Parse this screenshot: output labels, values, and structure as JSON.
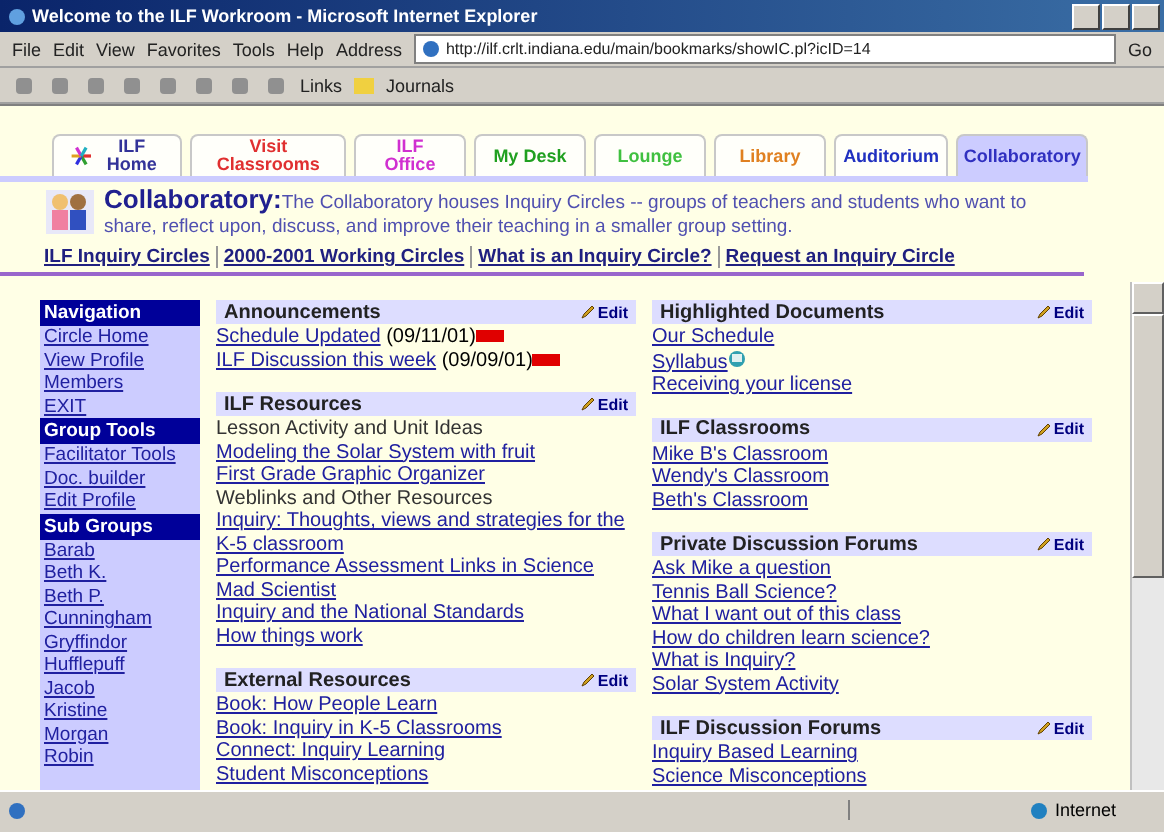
{
  "window": {
    "title": "Welcome to the ILF Workroom - Microsoft Internet Explorer"
  },
  "menu": [
    "File",
    "Edit",
    "View",
    "Favorites",
    "Tools",
    "Help"
  ],
  "address": {
    "label": "Address",
    "url": "http://ilf.crlt.indiana.edu/main/bookmarks/showIC.pl?icID=14",
    "go": "Go"
  },
  "links": {
    "label": "Links",
    "item": "Journals"
  },
  "tabs": [
    {
      "label": "ILF Home",
      "color": "#333399",
      "selected": false,
      "kind": "home"
    },
    {
      "label": "Visit Classrooms",
      "color": "#e03030",
      "selected": false,
      "kind": "text"
    },
    {
      "label": "ILF Office",
      "color": "#d030d0",
      "selected": false,
      "kind": "text"
    },
    {
      "label": "My Desk",
      "color": "#20a020",
      "selected": false,
      "kind": "text"
    },
    {
      "label": "Lounge",
      "color": "#40c040",
      "selected": false,
      "kind": "text"
    },
    {
      "label": "Library",
      "color": "#e08020",
      "selected": false,
      "kind": "text"
    },
    {
      "label": "Auditorium",
      "color": "#2030c0",
      "selected": false,
      "kind": "text"
    },
    {
      "label": "Collaboratory",
      "color": "#3030c0",
      "selected": true,
      "kind": "text"
    }
  ],
  "header": {
    "title": "Collaboratory:",
    "description": "The Collaboratory houses Inquiry Circles -- groups of teachers and students who want to share, reflect upon, discuss, and improve their teaching in a smaller group setting."
  },
  "nav_links": [
    "ILF Inquiry Circles",
    "2000-2001 Working Circles",
    "What is an Inquiry Circle?",
    "Request an Inquiry Circle"
  ],
  "sidebar": [
    {
      "title": "Navigation",
      "items": [
        "Circle Home",
        "View Profile",
        "Members",
        "EXIT"
      ]
    },
    {
      "title": "Group Tools",
      "items": [
        "Facilitator Tools",
        "Doc. builder",
        "Edit Profile"
      ]
    },
    {
      "title": "Sub Groups",
      "items": [
        "Barab",
        "Beth K.",
        "Beth P.",
        "Cunningham",
        "Gryffindor",
        "Hufflepuff",
        "Jacob",
        "Kristine",
        "Morgan",
        "Robin"
      ]
    }
  ],
  "columns": [
    [
      {
        "title": "Announcements",
        "edit": "Edit",
        "items": [
          {
            "kind": "link",
            "text": "Schedule Updated",
            "note": " (09/11/01)",
            "new": true
          },
          {
            "kind": "link",
            "text": "ILF Discussion this week",
            "note": " (09/09/01)",
            "new": true
          }
        ]
      },
      {
        "title": "ILF Resources",
        "edit": "Edit",
        "items": [
          {
            "kind": "text",
            "text": "Lesson Activity and Unit Ideas"
          },
          {
            "kind": "link",
            "text": "Modeling the Solar System with fruit"
          },
          {
            "kind": "link",
            "text": "First Grade Graphic Organizer"
          },
          {
            "kind": "text",
            "text": "Weblinks and Other Resources"
          },
          {
            "kind": "link",
            "text": "Inquiry: Thoughts, views and strategies for the K-5 classroom"
          },
          {
            "kind": "link",
            "text": "Performance Assessment Links in Science"
          },
          {
            "kind": "link",
            "text": "Mad Scientist"
          },
          {
            "kind": "link",
            "text": "Inquiry and the National Standards"
          },
          {
            "kind": "link",
            "text": "How things work"
          }
        ]
      },
      {
        "title": "External Resources",
        "edit": "Edit",
        "items": [
          {
            "kind": "link",
            "text": "Book: How People Learn"
          },
          {
            "kind": "link",
            "text": "Book: Inquiry in K-5 Classrooms"
          },
          {
            "kind": "link",
            "text": "Connect: Inquiry Learning"
          },
          {
            "kind": "link",
            "text": "Student Misconceptions"
          }
        ]
      }
    ],
    [
      {
        "title": "Highlighted Documents",
        "edit": "Edit",
        "items": [
          {
            "kind": "link",
            "text": "Our Schedule"
          },
          {
            "kind": "link",
            "text": "Syllabus",
            "doc": true
          },
          {
            "kind": "link",
            "text": "Receiving your license"
          }
        ]
      },
      {
        "title": "ILF Classrooms",
        "edit": "Edit",
        "items": [
          {
            "kind": "link",
            "text": "Mike B's Classroom"
          },
          {
            "kind": "link",
            "text": "Wendy's Classroom"
          },
          {
            "kind": "link",
            "text": "Beth's Classroom"
          }
        ]
      },
      {
        "title": "Private Discussion Forums",
        "edit": "Edit",
        "items": [
          {
            "kind": "link",
            "text": "Ask Mike a question"
          },
          {
            "kind": "link",
            "text": "Tennis Ball Science?"
          },
          {
            "kind": "link",
            "text": "What I want out of this class"
          },
          {
            "kind": "link",
            "text": "How do children learn science?"
          },
          {
            "kind": "link",
            "text": "What is Inquiry?"
          },
          {
            "kind": "link",
            "text": "Solar System Activity"
          }
        ]
      },
      {
        "title": "ILF Discussion Forums",
        "edit": "Edit",
        "items": [
          {
            "kind": "link",
            "text": "Inquiry Based Learning"
          },
          {
            "kind": "link",
            "text": "Science Misconceptions"
          }
        ]
      }
    ]
  ],
  "status_bar": {
    "zone": "Internet"
  }
}
